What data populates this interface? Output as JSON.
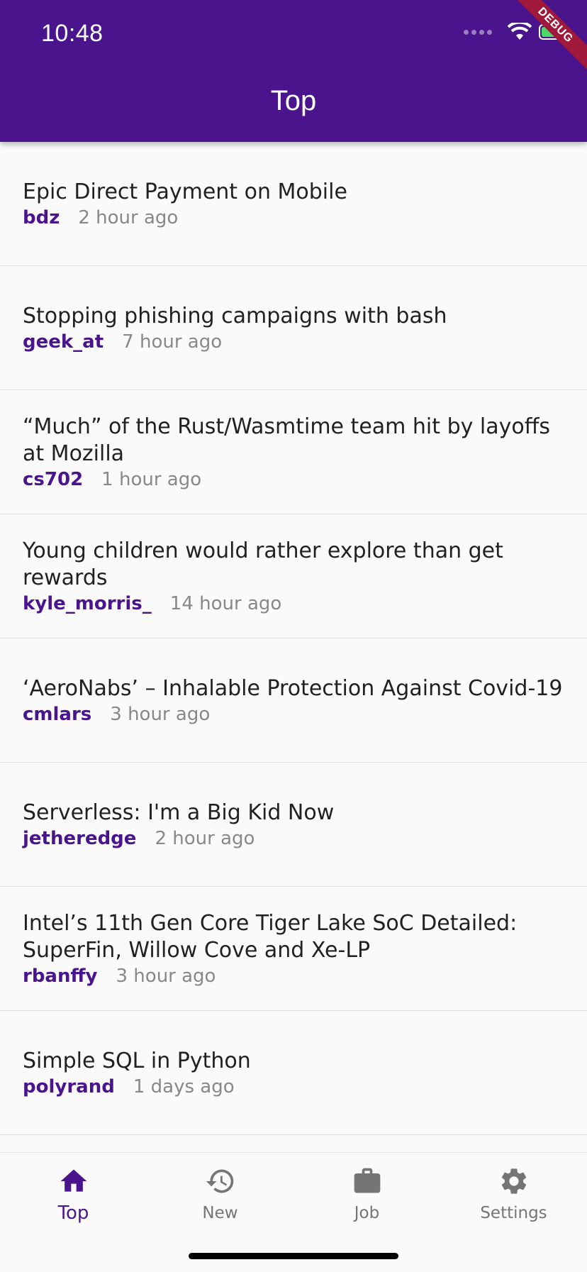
{
  "status_bar": {
    "time": "10:48",
    "debug_label": "DEBUG"
  },
  "appbar": {
    "title": "Top"
  },
  "stories": [
    {
      "title": "Epic Direct Payment on Mobile",
      "author": "bdz",
      "time": "2 hour ago"
    },
    {
      "title": "Stopping phishing campaigns with bash",
      "author": "geek_at",
      "time": "7 hour ago"
    },
    {
      "title": "“Much” of the Rust/Wasmtime team hit by layoffs at Mozilla",
      "author": "cs702",
      "time": "1 hour ago"
    },
    {
      "title": "Young children would rather explore than get rewards",
      "author": "kyle_morris_",
      "time": "14 hour ago"
    },
    {
      "title": "‘AeroNabs’ – Inhalable Protection Against Covid-19",
      "author": "cmlars",
      "time": "3 hour ago"
    },
    {
      "title": "Serverless: I'm a Big Kid Now",
      "author": "jetheredge",
      "time": "2 hour ago"
    },
    {
      "title": "Intel’s 11th Gen Core Tiger Lake SoC Detailed: SuperFin, Willow Cove and Xe-LP",
      "author": "rbanffy",
      "time": "3 hour ago"
    },
    {
      "title": "Simple SQL in Python",
      "author": "polyrand",
      "time": "1 days ago"
    }
  ],
  "bottom_nav": {
    "items": [
      {
        "label": "Top",
        "icon": "home-icon",
        "active": true
      },
      {
        "label": "New",
        "icon": "history-icon",
        "active": false
      },
      {
        "label": "Job",
        "icon": "briefcase-icon",
        "active": false
      },
      {
        "label": "Settings",
        "icon": "gear-icon",
        "active": false
      }
    ]
  },
  "colors": {
    "primary": "#4a148c",
    "inactive": "#757575",
    "debug": "#a0183a"
  }
}
